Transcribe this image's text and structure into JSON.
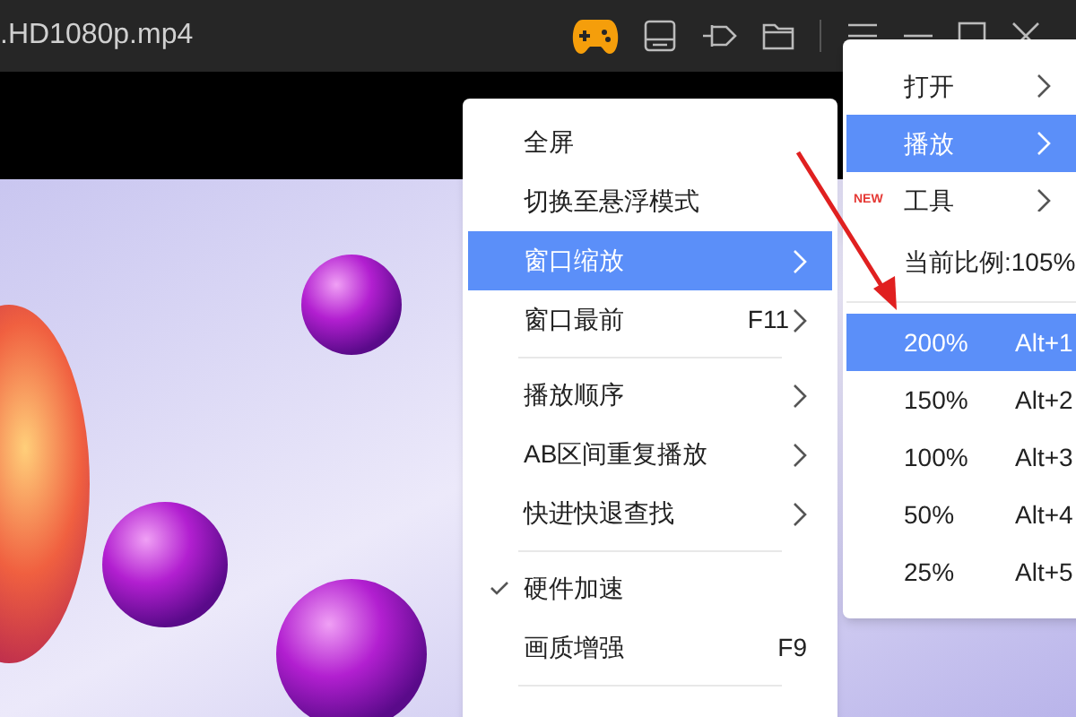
{
  "window": {
    "title": ".HD1080p.mp4"
  },
  "context_menu": {
    "items": [
      {
        "kind": "item",
        "label": "全屏",
        "selected": false,
        "checked": false,
        "submenu": false
      },
      {
        "kind": "item",
        "label": "切换至悬浮模式",
        "selected": false,
        "checked": false,
        "submenu": false
      },
      {
        "kind": "item",
        "label": "窗口缩放",
        "selected": true,
        "checked": false,
        "submenu": true
      },
      {
        "kind": "item",
        "label": "窗口最前",
        "shortcut": "F11",
        "selected": false,
        "checked": false,
        "submenu": true
      },
      {
        "kind": "separator"
      },
      {
        "kind": "item",
        "label": "播放顺序",
        "selected": false,
        "checked": false,
        "submenu": true
      },
      {
        "kind": "item",
        "label": "AB区间重复播放",
        "selected": false,
        "checked": false,
        "submenu": true
      },
      {
        "kind": "item",
        "label": "快进快退查找",
        "selected": false,
        "checked": false,
        "submenu": true
      },
      {
        "kind": "separator"
      },
      {
        "kind": "item",
        "label": "硬件加速",
        "selected": false,
        "checked": true,
        "submenu": false
      },
      {
        "kind": "item",
        "label": "画质增强",
        "shortcut": "F9",
        "selected": false,
        "checked": false,
        "submenu": false
      },
      {
        "kind": "separator"
      }
    ]
  },
  "main_menu": {
    "items": [
      {
        "label": "打开",
        "selected": false
      },
      {
        "label": "播放",
        "selected": true
      },
      {
        "label": "工具",
        "badge": "NEW",
        "selected": false
      }
    ]
  },
  "zoom_submenu": {
    "current": "当前比例:105%",
    "options": [
      {
        "label": "200%",
        "shortcut": "Alt+1",
        "selected": true
      },
      {
        "label": "150%",
        "shortcut": "Alt+2",
        "selected": false
      },
      {
        "label": "100%",
        "shortcut": "Alt+3",
        "selected": false
      },
      {
        "label": "50%",
        "shortcut": "Alt+4",
        "selected": false
      },
      {
        "label": "25%",
        "shortcut": "Alt+5",
        "selected": false
      }
    ]
  }
}
